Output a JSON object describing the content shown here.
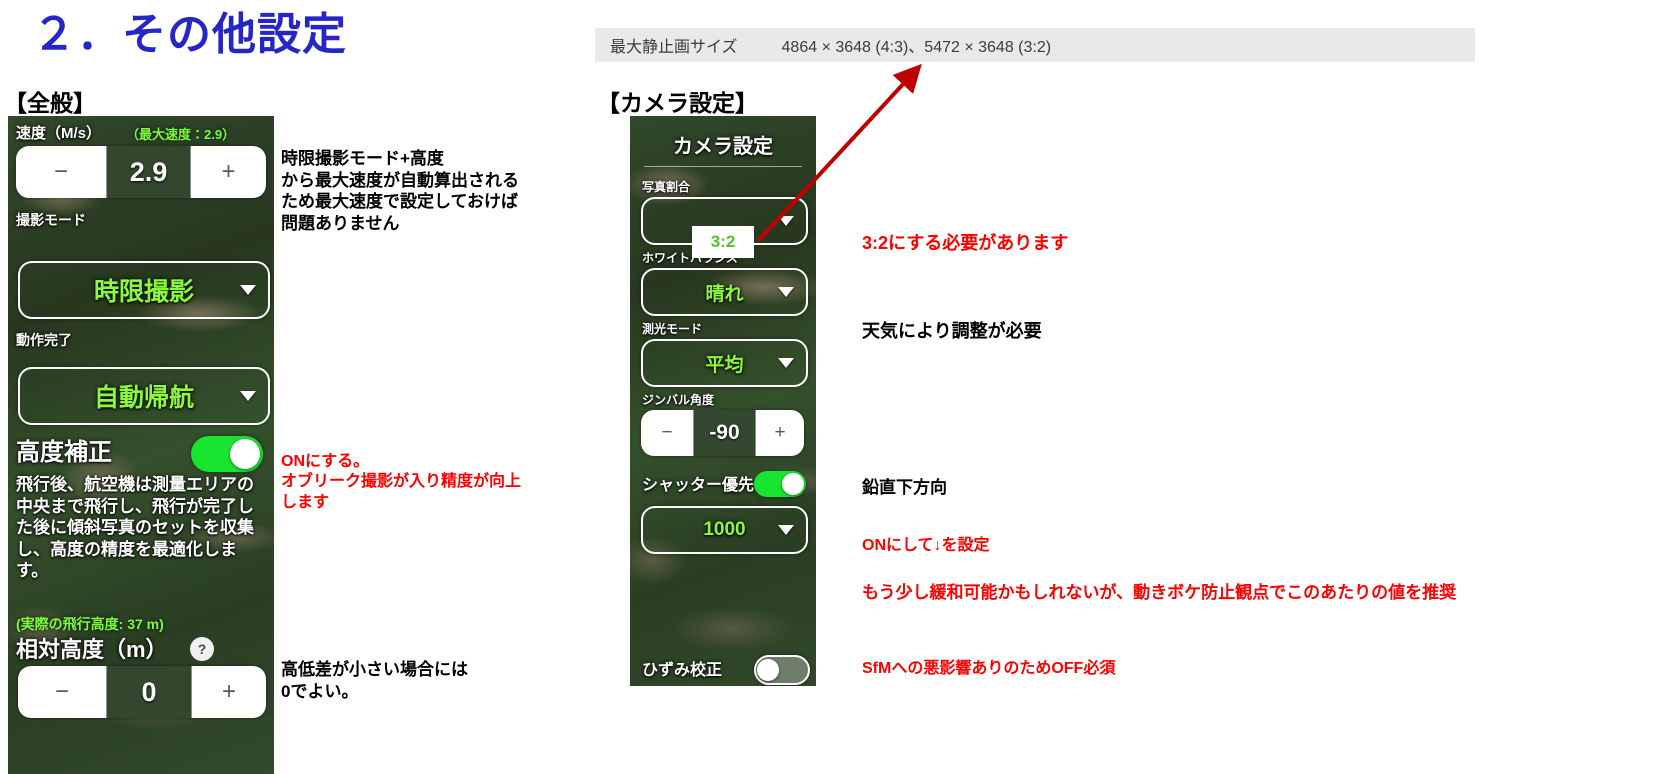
{
  "slide": {
    "title": "２．その他設定",
    "section_general": "【全般】",
    "section_camera": "【カメラ設定】"
  },
  "spec_banner": {
    "label": "最大静止画サイズ",
    "value": "4864 × 3648 (4:3)、5472 × 3648 (3:2)"
  },
  "general_panel": {
    "speed": {
      "label": "速度（M/s）",
      "max_note": "（最大速度：2.9）",
      "minus": "−",
      "value": "2.9",
      "plus": "+"
    },
    "shoot_mode": {
      "label": "撮影モード",
      "value": "時限撮影"
    },
    "on_complete": {
      "label": "動作完了",
      "value": "自動帰航"
    },
    "altitude_correction": {
      "label": "高度補正",
      "toggle_state": "ON",
      "description": "飛行後、航空機は測量エリアの中央まで飛行し、飛行が完了した後に傾斜写真のセットを収集し、高度の精度を最適化します。"
    },
    "relative_altitude": {
      "actual_note": "(実際の飛行高度: 37 m)",
      "label": "相対高度（m）",
      "help_icon": "?",
      "minus": "−",
      "value": "0",
      "plus": "+"
    }
  },
  "camera_panel": {
    "title": "カメラ設定",
    "photo_ratio": {
      "label": "写真割合",
      "value": "3:2"
    },
    "white_balance": {
      "label": "ホワイトバランス",
      "value": "晴れ"
    },
    "metering_mode": {
      "label": "測光モード",
      "value": "平均"
    },
    "gimbal_angle": {
      "label": "ジンバル角度",
      "minus": "−",
      "value": "-90",
      "plus": "+"
    },
    "shutter_priority": {
      "label": "シャッター優先",
      "toggle_state": "ON",
      "value": "1000"
    },
    "distortion_correction": {
      "label": "ひずみ校正",
      "toggle_state": "OFF"
    }
  },
  "annotations": {
    "speed_note": "時限撮影モード+高度\nから最大速度が自動算出される\nため最大速度で設定しておけば\n問題ありません",
    "altitude_correction_note": "ONにする。\nオブリーク撮影が入り精度が向上\nします",
    "relative_altitude_note": "高低差が小さい場合には\n0でよい。",
    "photo_ratio_note": "3:2にする必要があります",
    "white_balance_note": "天気により調整が必要",
    "gimbal_note": "鉛直下方向",
    "shutter_priority_note": "ONにして↓を設定",
    "shutter_value_note": "もう少し緩和可能かもしれないが、動きボケ防止観点でこのあたりの値を推奨",
    "distortion_note": "SfMへの悪影響ありのためOFF必須"
  },
  "colors": {
    "title_blue": "#2626c8",
    "note_red": "#ff0000",
    "panel_green_text": "#8cf93d",
    "toggle_on": "#17e52f",
    "arrow_red": "#c00000",
    "banner_bg": "#e9e9e9"
  }
}
